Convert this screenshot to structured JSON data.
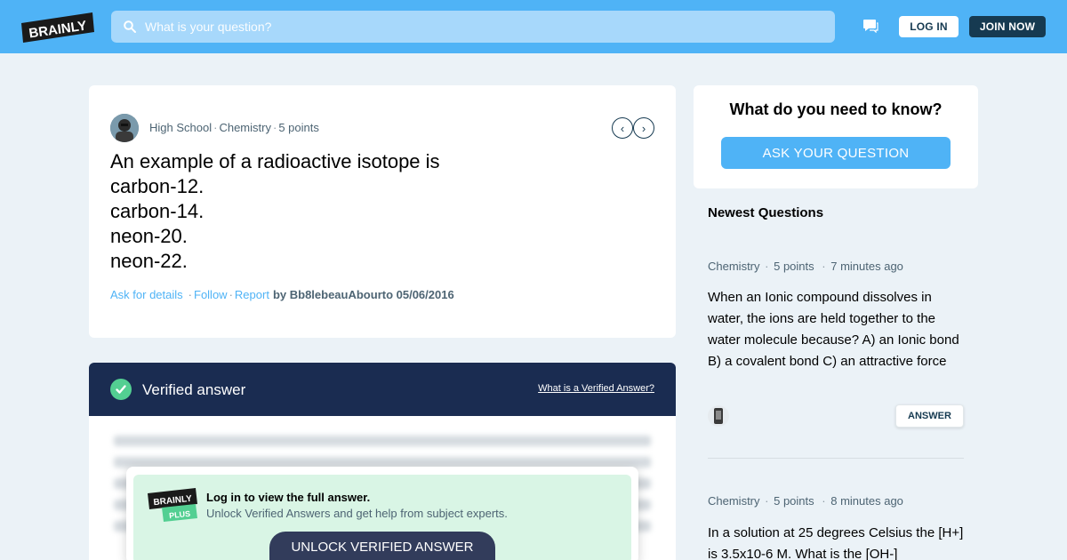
{
  "header": {
    "logo_text": "BRAINLY",
    "search_placeholder": "What is your question?",
    "login_label": "LOG IN",
    "join_label": "JOIN NOW"
  },
  "question": {
    "grade": "High School",
    "subject": "Chemistry",
    "points": "5 points",
    "lines": [
      "An example of a radioactive isotope is",
      "carbon-12.",
      "carbon-14.",
      "neon-20.",
      "neon-22."
    ],
    "ask_details": "Ask for details",
    "follow": "Follow",
    "report": "Report",
    "by_line": "by Bb8lebeauAbourto 05/06/2016"
  },
  "answer": {
    "verified_title": "Verified answer",
    "verified_link": "What is a Verified Answer?",
    "login_title": "Log in to view the full answer.",
    "login_subtitle": "Unlock Verified Answers and get help from subject experts.",
    "unlock_label": "UNLOCK VERIFIED ANSWER",
    "plus_logo_top": "BRAINLY",
    "plus_logo_bottom": "PLUS"
  },
  "sidebar": {
    "ask_title": "What do you need to know?",
    "ask_button": "ASK YOUR QUESTION",
    "newest_title": "Newest Questions",
    "questions": [
      {
        "subject": "Chemistry",
        "points": "5 points",
        "time": "7 minutes ago",
        "text": "When an Ionic compound dissolves in water, the ions are held together to the water molecule because? A) an Ionic bond B) a covalent bond C) an attractive force",
        "answer_label": "ANSWER"
      },
      {
        "subject": "Chemistry",
        "points": "5 points",
        "time": "8 minutes ago",
        "text": "In a solution at 25 degrees Celsius the [H+] is 3.5x10-6 M. What is the [OH-]"
      }
    ]
  },
  "colors": {
    "brand_blue": "#4fb3f6",
    "navy": "#163a51",
    "verified_header": "#1a2c51",
    "verified_green": "#53cf92",
    "unlock_bg": "#d9f5e5",
    "unlock_button": "#323c5b"
  },
  "icons": [
    "search-icon",
    "chat-icon",
    "chevron-left-icon",
    "chevron-right-icon",
    "check-icon"
  ]
}
